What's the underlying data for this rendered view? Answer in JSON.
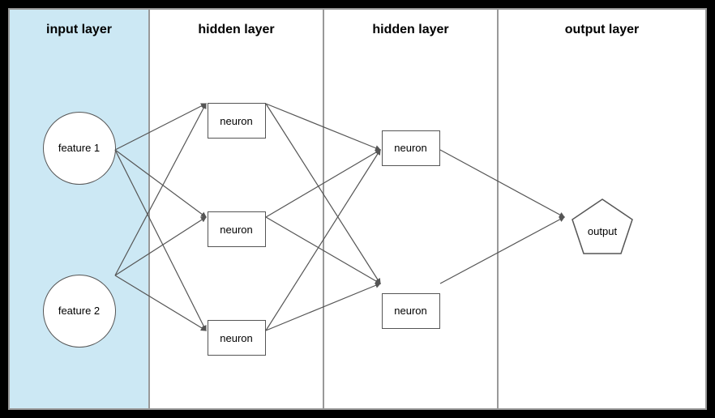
{
  "layers": [
    {
      "id": "input-layer",
      "title": "input layer",
      "type": "input",
      "nodes": [
        {
          "label": "feature 1"
        },
        {
          "label": "feature 2"
        }
      ]
    },
    {
      "id": "hidden-layer-1",
      "title": "hidden layer",
      "type": "hidden",
      "nodes": [
        {
          "label": "neuron"
        },
        {
          "label": "neuron"
        },
        {
          "label": "neuron"
        }
      ]
    },
    {
      "id": "hidden-layer-2",
      "title": "hidden layer",
      "type": "hidden",
      "nodes": [
        {
          "label": "neuron"
        },
        {
          "label": "neuron"
        }
      ]
    },
    {
      "id": "output-layer",
      "title": "output layer",
      "type": "output",
      "nodes": [
        {
          "label": "output"
        }
      ]
    }
  ],
  "colors": {
    "input_bg": "#cce8f4",
    "hidden_bg": "#ffffff",
    "output_bg": "#ffffff",
    "border": "#888888",
    "black": "#000000",
    "line": "#555555"
  }
}
